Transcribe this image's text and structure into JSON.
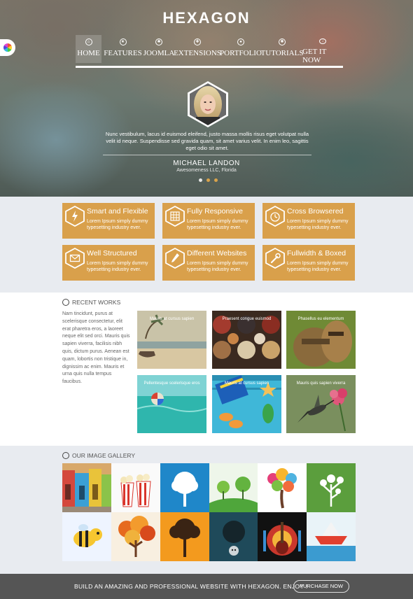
{
  "brand": {
    "logo": "HEXAGON"
  },
  "nav": {
    "items": [
      {
        "label": "HOME",
        "icon": "home-icon"
      },
      {
        "label": "FEATURES",
        "icon": "star-icon"
      },
      {
        "label": "JOOMLA",
        "icon": "joomla-icon"
      },
      {
        "label": "EXTENSIONS",
        "icon": "puzzle-icon"
      },
      {
        "label": "PORTFOLIO",
        "icon": "portfolio-icon"
      },
      {
        "label": "TUTORIALS",
        "icon": "gear-icon"
      },
      {
        "label": "GET IT NOW",
        "icon": "download-icon"
      }
    ]
  },
  "testimonial": {
    "quote": "Nunc vestibulum, lacus id euismod eleifend, justo massa mollis risus eget volutpat nulla velit id neque. Suspendisse sed gravida quam, sit amet varius velit. In enim leo, sagittis eget odio sit amet.",
    "name": "MICHAEL LANDON",
    "company": "Awesomeness LLC, Florida"
  },
  "features": [
    {
      "title": "Smart and Flexible",
      "desc": "Lorem Ipsum simply dummy typesetting industry ever.",
      "icon": "lightning-icon"
    },
    {
      "title": "Fully Responsive",
      "desc": "Lorem Ipsum simply dummy typesetting industry ever.",
      "icon": "grid-icon"
    },
    {
      "title": "Cross Browsered",
      "desc": "Lorem Ipsum simply dummy typesetting industry ever.",
      "icon": "clock-icon"
    },
    {
      "title": "Well Structured",
      "desc": "Lorem Ipsum simply dummy typesetting industry ever.",
      "icon": "envelope-icon"
    },
    {
      "title": "Different Websites",
      "desc": "Lorem Ipsum simply dummy typesetting industry ever.",
      "icon": "pencil-icon"
    },
    {
      "title": "Fullwidth & Boxed",
      "desc": "Lorem Ipsum simply dummy typesetting industry ever.",
      "icon": "wrench-icon"
    }
  ],
  "recent_works": {
    "title": "RECENT WORKS",
    "text": "Nam tincidunt, purus at scelerisque consectetur, elit erat pharetra eros, a laoreet neque elit sed orci. Mauris quis sapien viverra, facilisis nibh quis, dictum purus. Aenean est quam, lobortis non tristique in, dignissim ac enim. Mauris et urna quis nulla tempus faucibus.",
    "items": [
      {
        "caption": "Mauris at cursus sapien"
      },
      {
        "caption": "Praesent congue euismod"
      },
      {
        "caption": "Phasellus eu elementum"
      },
      {
        "caption": "Pellentesque scelerisque eros"
      },
      {
        "caption": "Mauris at cursus sapien"
      },
      {
        "caption": "Mauris quis sapien viverra"
      }
    ]
  },
  "gallery": {
    "title": "OUR IMAGE GALLERY",
    "images": [
      "colorful-houses",
      "popcorn",
      "blue-tree",
      "green-hills-trees",
      "colorful-tree",
      "white-tree-green",
      "bee",
      "autumn-tree",
      "orange-tree-silhouette",
      "dark-circle-tree",
      "guitar-poster",
      "paper-boat"
    ]
  },
  "footer": {
    "text": "BUILD AN AMAZING AND PROFESSIONAL WEBSITE WITH HEXAGON. ENJOY !",
    "button": "PURCHASE NOW"
  },
  "colors": {
    "accent": "#d9a04b",
    "footer": "#555555",
    "section_bg": "#e8ebf0"
  }
}
